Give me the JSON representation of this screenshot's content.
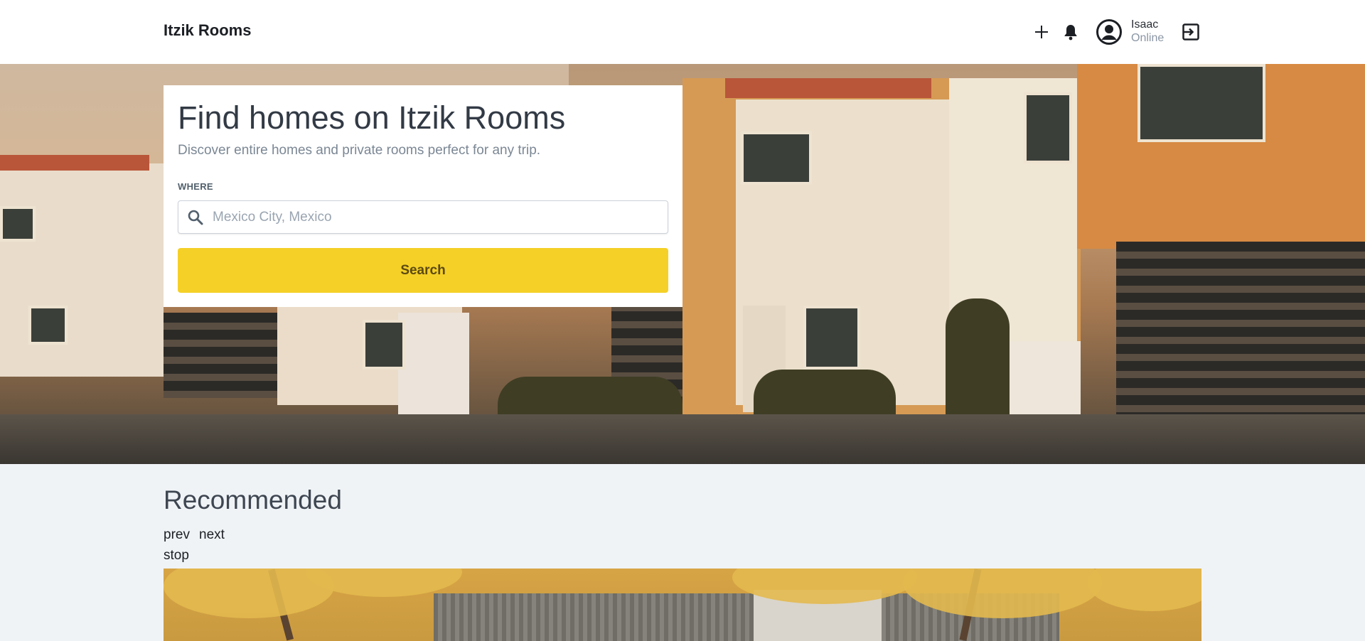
{
  "header": {
    "brand": "Itzik Rooms",
    "user": {
      "name": "Isaac",
      "status": "Online"
    },
    "icons": [
      "plus-icon",
      "bell-icon",
      "user-circle-icon",
      "logout-icon"
    ]
  },
  "search_card": {
    "title": "Find homes on Itzik Rooms",
    "subtitle": "Discover entire homes and private rooms perfect for any trip.",
    "where_label": "WHERE",
    "where_placeholder": "Mexico City, Mexico",
    "where_value": "",
    "button_label": "Search"
  },
  "recommended": {
    "title": "Recommended",
    "prev_label": "prev",
    "next_label": "next",
    "stop_label": "stop"
  },
  "colors": {
    "accent": "#f5d027",
    "header_bg": "#ffffff",
    "page_bg": "#f0f3f6"
  }
}
